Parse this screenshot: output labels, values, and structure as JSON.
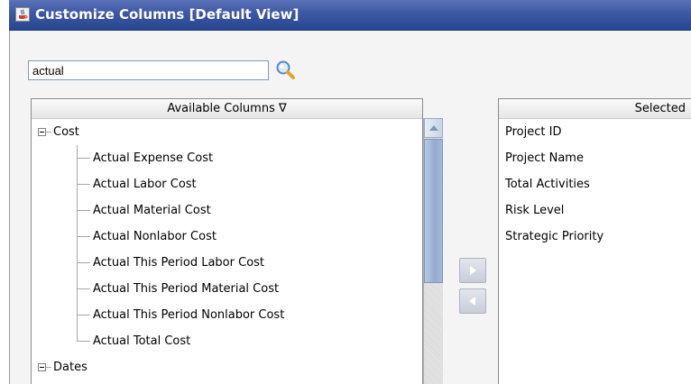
{
  "window": {
    "title": "Customize Columns [Default View]"
  },
  "search": {
    "value": "actual",
    "placeholder": ""
  },
  "available": {
    "header": "Available Columns ∇",
    "categories": [
      {
        "label": "Cost",
        "expanded": true,
        "items": [
          "Actual Expense Cost",
          "Actual Labor Cost",
          "Actual Material Cost",
          "Actual Nonlabor Cost",
          "Actual This Period Labor Cost",
          "Actual This Period Material Cost",
          "Actual This Period Nonlabor Cost",
          "Actual Total Cost"
        ]
      },
      {
        "label": "Dates",
        "expanded": true,
        "items": []
      }
    ]
  },
  "selected": {
    "header": "Selected",
    "items": [
      "Project ID",
      "Project Name",
      "Total Activities",
      "Risk Level",
      "Strategic Priority"
    ]
  },
  "icons": {
    "app": "java-cup-icon",
    "search": "magnifier-icon",
    "move_right": "arrow-right-icon",
    "move_left": "arrow-left-icon"
  },
  "colors": {
    "titlebar": "#3c57a3",
    "scroll_thumb": "#93abd0"
  }
}
